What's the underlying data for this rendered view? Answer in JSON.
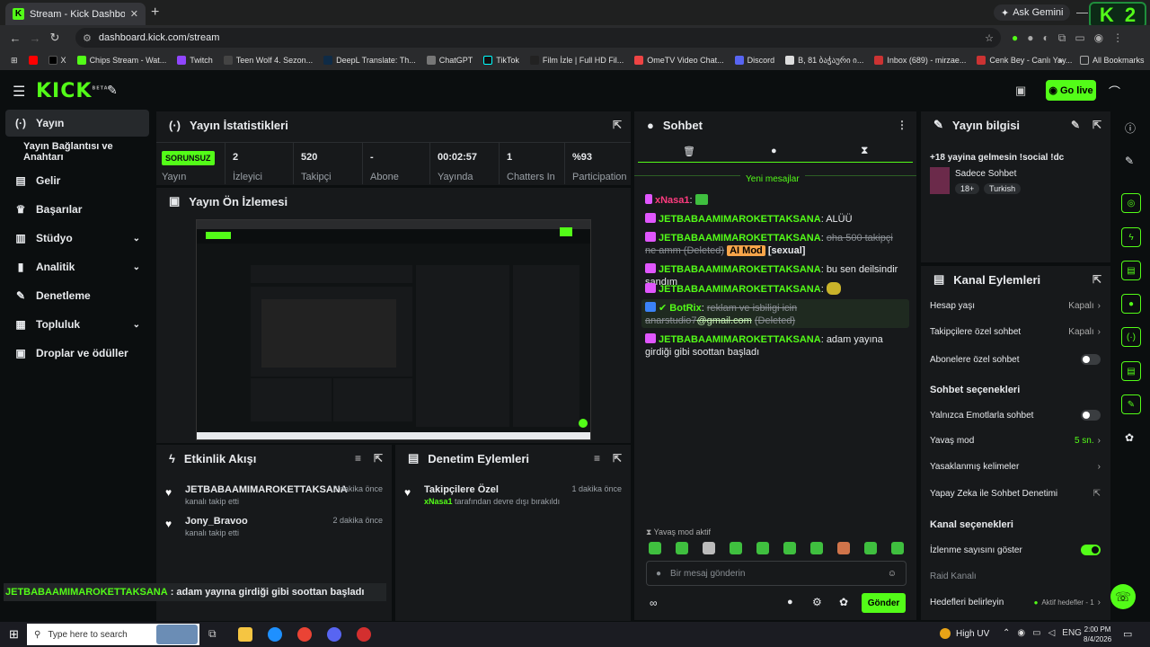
{
  "browser": {
    "tab_title": "Stream - Kick Dashboard",
    "url": "dashboard.kick.com/stream",
    "gemini": "Ask Gemini",
    "badge_number": "2",
    "all_bookmarks": "All Bookmarks",
    "bookmarks": [
      "X",
      "Chips Stream - Wat...",
      "Twitch",
      "Teen Wolf 4. Sezon...",
      "DeepL Translate: Th...",
      "ChatGPT",
      "TikTok",
      "Film İzle | Full HD Fil...",
      "OmeTV Video Chat...",
      "Discord",
      "B, 81 ბაჭაური ი...",
      "Inbox (689) - mirzae...",
      "Cenk Bey - Canlı Yay..."
    ]
  },
  "header": {
    "logo": "KICK",
    "beta": "BETA",
    "go_live": "Go live"
  },
  "sidebar": {
    "items": [
      {
        "label": "Yayın",
        "icon": "broadcast-icon"
      },
      {
        "label": "Yayın Bağlantısı ve Anahtarı",
        "icon": ""
      },
      {
        "label": "Gelir",
        "icon": "money-icon"
      },
      {
        "label": "Başarılar",
        "icon": "trophy-icon"
      },
      {
        "label": "Stüdyo",
        "icon": "studio-icon"
      },
      {
        "label": "Analitik",
        "icon": "chart-icon"
      },
      {
        "label": "Denetleme",
        "icon": "wrench-icon"
      },
      {
        "label": "Topluluk",
        "icon": "community-icon"
      },
      {
        "label": "Droplar ve ödüller",
        "icon": "gift-icon"
      }
    ]
  },
  "stats": {
    "title": "Yayın İstatistikleri",
    "status": "SORUNSUZ",
    "status_label": "Yayın",
    "cells": [
      {
        "value": "2",
        "label": "İzleyici"
      },
      {
        "value": "520",
        "label": "Takipçi"
      },
      {
        "value": "-",
        "label": "Abone"
      },
      {
        "value": "00:02:57",
        "label": "Yayında"
      },
      {
        "value": "1",
        "label": "Chatters In"
      },
      {
        "value": "%93",
        "label": "Participation"
      }
    ]
  },
  "preview": {
    "title": "Yayın Ön İzlemesi"
  },
  "activity": {
    "title": "Etkinlik Akışı",
    "items": [
      {
        "name": "JETBABAAMIMAROKETTAKSANA",
        "sub": "kanalı takip etti",
        "time": "2 dakika önce"
      },
      {
        "name": "Jony_Bravoo",
        "sub": "kanalı takip etti",
        "time": "2 dakika önce"
      }
    ]
  },
  "moderation": {
    "title": "Denetim Eylemleri",
    "items": [
      {
        "name": "Takipçilere Özel",
        "user": "xNasa1",
        "sub": "tarafından devre dışı bırakıldı",
        "time": "1 dakika önce"
      }
    ]
  },
  "overlay_text": {
    "user": "JETBABAAMIMAROKETTAKSANA",
    "text": ": adam yayına girdiği gibi soottan başladı"
  },
  "chat": {
    "title": "Sohbet",
    "new_messages": "Yeni mesajlar",
    "messages": [
      {
        "user": "xNasa1",
        "text": ""
      },
      {
        "user": "JETBABAAMIMAROKETTAKSANA",
        "text": "ALÜÜ"
      },
      {
        "user": "JETBABAAMIMAROKETTAKSANA",
        "deleted": "oha 500 takipçi ne amm (Deleted)",
        "badge": "AI Mod",
        "tag": "[sexual]"
      },
      {
        "user": "JETBABAAMIMAROKETTAKSANA",
        "text": "bu sen deilsindir sandım"
      },
      {
        "user": "JETBABAAMIMAROKETTAKSANA",
        "text": ""
      },
      {
        "user": "BotRix",
        "deleted": "reklam ve isbiligi icin anarstudio7",
        "email": "@gmail.com",
        "deleted_tail": "(Deleted)"
      },
      {
        "user": "JETBABAAMIMAROKETTAKSANA",
        "text": "adam yayına girdiği gibi soottan başladı"
      }
    ],
    "slow_mode": "Yavaş mod aktif",
    "placeholder": "Bir mesaj gönderin",
    "send": "Gönder"
  },
  "info": {
    "title": "Yayın bilgisi",
    "stream_title": "+18 yayina gelmesin !social !dc",
    "category": "Sadece Sohbet",
    "tags": [
      "18+",
      "Turkish"
    ]
  },
  "channel_actions": {
    "title": "Kanal Eylemleri",
    "rows": [
      {
        "label": "Hesap yaşı",
        "value": "Kapalı"
      },
      {
        "label": "Takipçilere özel sohbet",
        "value": "Kapalı"
      },
      {
        "label": "Abonelere özel sohbet",
        "value": ""
      }
    ],
    "chat_options_title": "Sohbet seçenekleri",
    "chat_rows": [
      {
        "label": "Yalnızca Emotlarla sohbet",
        "value": ""
      },
      {
        "label": "Yavaş mod",
        "value": "5 sn."
      },
      {
        "label": "Yasaklanmış kelimeler",
        "value": ""
      },
      {
        "label": "Yapay Zeka ile Sohbet Denetimi",
        "value": ""
      }
    ],
    "channel_options_title": "Kanal seçenekleri",
    "channel_rows": [
      {
        "label": "İzlenme sayısını göster",
        "value": ""
      },
      {
        "label": "Raid Kanalı",
        "value": ""
      },
      {
        "label": "Hedefleri belirleyin",
        "value": "Aktif hedefler - 1"
      }
    ]
  },
  "taskbar": {
    "search": "Type here to search",
    "weather": "High UV",
    "lang": "ENG",
    "time": "2:00 PM",
    "date": "8/4/2026"
  }
}
